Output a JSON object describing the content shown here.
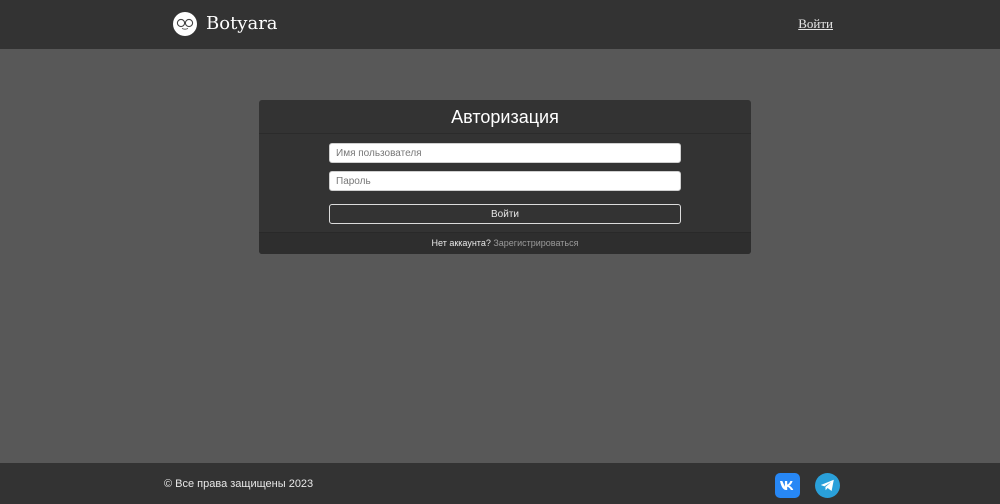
{
  "header": {
    "brand": "Botyara",
    "logo_icon": "glasses-logo-icon",
    "login_link": "Войти"
  },
  "auth_card": {
    "title": "Авторизация",
    "username_placeholder": "Имя пользователя",
    "password_placeholder": "Пароль",
    "submit_label": "Войти",
    "no_account_text": "Нет аккаунта?",
    "register_link": "Зарегистрироваться"
  },
  "footer": {
    "copyright": "© Все права защищены 2023",
    "social": [
      {
        "icon": "vk-icon",
        "color": "#2787f5"
      },
      {
        "icon": "telegram-icon",
        "color": "#2aa0da"
      }
    ]
  },
  "colors": {
    "background": "#585858",
    "header_bg": "#333333",
    "card_bg": "#333333"
  }
}
